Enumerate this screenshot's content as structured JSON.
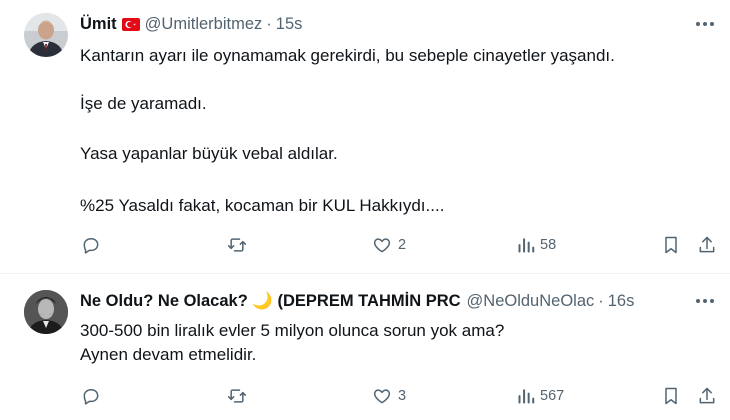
{
  "colors": {
    "text": "#0f1419",
    "muted": "#536471",
    "divider": "#eff3f4"
  },
  "tweets": [
    {
      "name": "Ümit",
      "flag": "turkey-flag-icon",
      "handle": "@Umitlerbitmez",
      "separator": "·",
      "time": "15s",
      "lines": [
        "Kantarın ayarı ile oynamamak gerekirdi, bu sebeple cinayetler yaşandı.",
        "İşe de yaramadı.",
        "Yasa yapanlar büyük vebal aldılar.",
        "%25 Yasaldı fakat, kocaman bir KUL Hakkıydı...."
      ],
      "actions": {
        "reply_count": "",
        "retweet_count": "",
        "like_count": "2",
        "views_count": "58"
      }
    },
    {
      "name": "Ne Oldu? Ne Olacak? 🌙 (DEPREM TAHMİN PRC",
      "handle": "@NeOlduNeOlac",
      "separator": "·",
      "time": "16s",
      "lines": [
        "300-500 bin liralık evler 5 milyon olunca sorun yok ama?",
        "Aynen devam etmelidir."
      ],
      "actions": {
        "reply_count": "",
        "retweet_count": "",
        "like_count": "3",
        "views_count": "567"
      }
    }
  ]
}
